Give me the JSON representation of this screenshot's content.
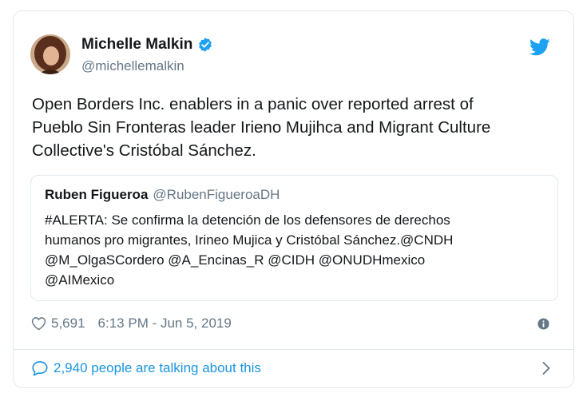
{
  "author": {
    "name": "Michelle Malkin",
    "handle": "@michellemalkin"
  },
  "tweet": {
    "lines": [
      "Open Borders Inc. enablers in a panic over reported arrest of",
      "Pueblo Sin Fronteras leader Irieno Mujihca and Migrant Culture",
      "Collective's Cristóbal Sánchez."
    ]
  },
  "quoted": {
    "name": "Ruben Figueroa",
    "handle": "@RubenFigueroaDH",
    "lines": [
      "#ALERTA: Se confirma la detención de los defensores de derechos",
      "humanos pro migrantes, Irineo Mujica y Cristóbal Sánchez.@CNDH",
      "@M_OlgaSCordero @A_Encinas_R @CIDH @ONUDHmexico",
      "@AIMexico"
    ]
  },
  "meta": {
    "likes": "5,691",
    "timestamp": "6:13 PM - Jun 5, 2019"
  },
  "talking": "2,940 people are talking about this",
  "colors": {
    "accent": "#1da1f2",
    "link": "#1b95e0",
    "secondary_text": "#657786",
    "border": "#e1e8ed"
  },
  "icons": [
    "verified-badge-icon",
    "twitter-bird-icon",
    "heart-icon",
    "info-icon",
    "speech-bubble-icon",
    "chevron-right-icon"
  ]
}
